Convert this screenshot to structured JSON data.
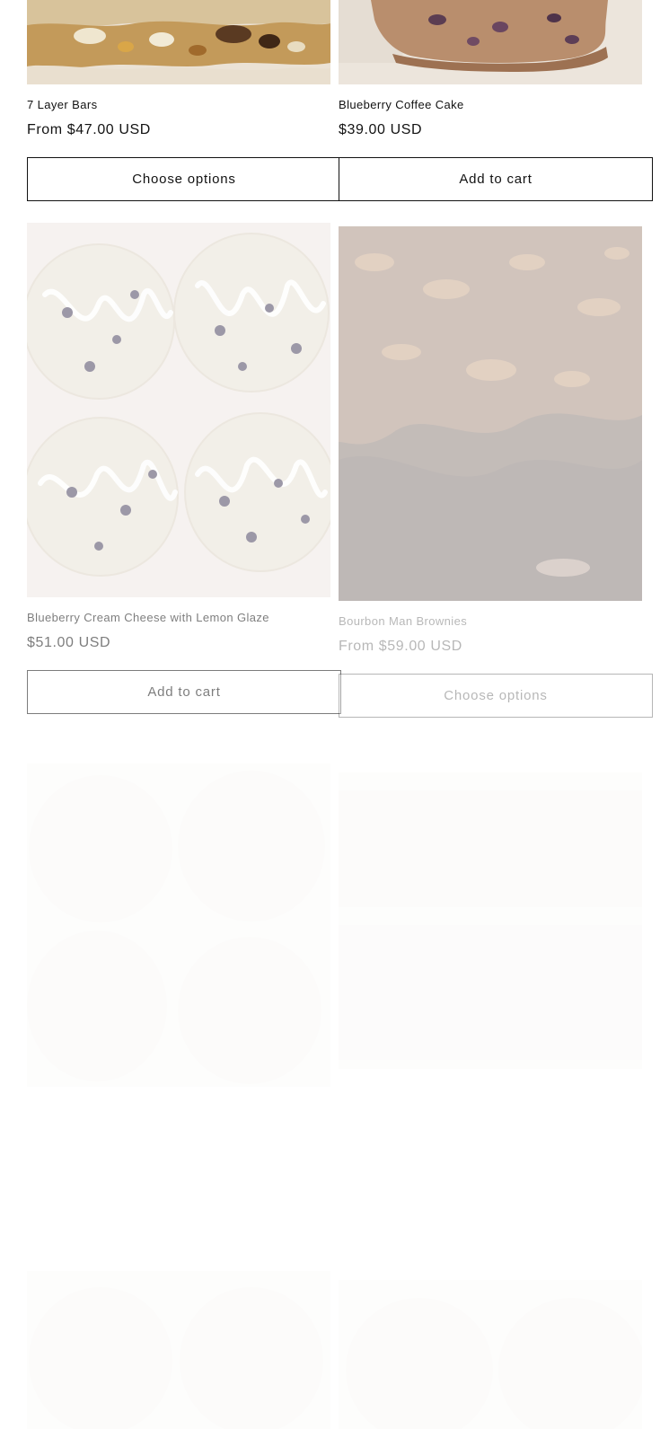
{
  "products": [
    {
      "title": "7 Layer Bars",
      "price": "From $47.00 USD",
      "button": "Choose options",
      "image": "seven-layer-bar-photo"
    },
    {
      "title": "Blueberry Coffee Cake",
      "price": "$39.00 USD",
      "button": "Add to cart",
      "image": "blueberry-coffee-cake-photo"
    },
    {
      "title": "Blueberry Cream Cheese with Lemon Glaze",
      "price": "$51.00 USD",
      "button": "Add to cart",
      "image": "blueberry-cookies-photo"
    },
    {
      "title": "Bourbon Man Brownies",
      "price": "From $59.00 USD",
      "button": "Choose options",
      "image": "bourbon-brownies-photo"
    }
  ],
  "colors": {
    "text": "#121212",
    "button_border": "#121212",
    "background": "#ffffff"
  }
}
